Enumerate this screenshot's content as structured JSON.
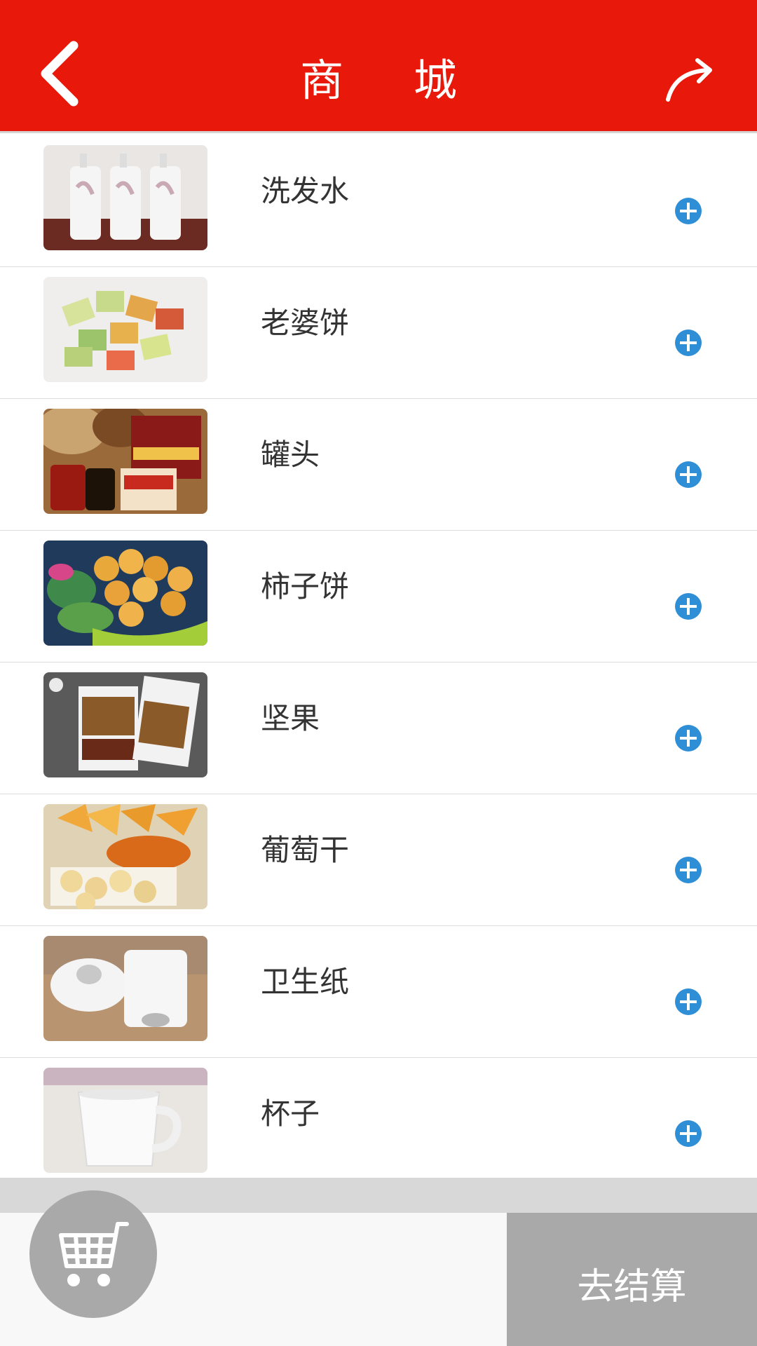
{
  "header": {
    "title": "商 城",
    "back_icon": "chevron-left-icon",
    "share_icon": "share-arrow-icon",
    "bg_color": "#e8190a"
  },
  "products": [
    {
      "name": "洗发水",
      "image": "shampoo-bottles"
    },
    {
      "name": "老婆饼",
      "image": "wrapped-pastries"
    },
    {
      "name": "罐头",
      "image": "canned-goods"
    },
    {
      "name": "柿子饼",
      "image": "dried-persimmons"
    },
    {
      "name": "坚果",
      "image": "nut-packages"
    },
    {
      "name": "葡萄干",
      "image": "dried-fruit"
    },
    {
      "name": "卫生纸",
      "image": "toilet-paper"
    },
    {
      "name": "杯子",
      "image": "white-cup"
    }
  ],
  "add_icon": "plus-circle-icon",
  "accent_color": "#2f8fd6",
  "footer": {
    "cart_icon": "shopping-cart-icon",
    "checkout_label": "去结算"
  }
}
